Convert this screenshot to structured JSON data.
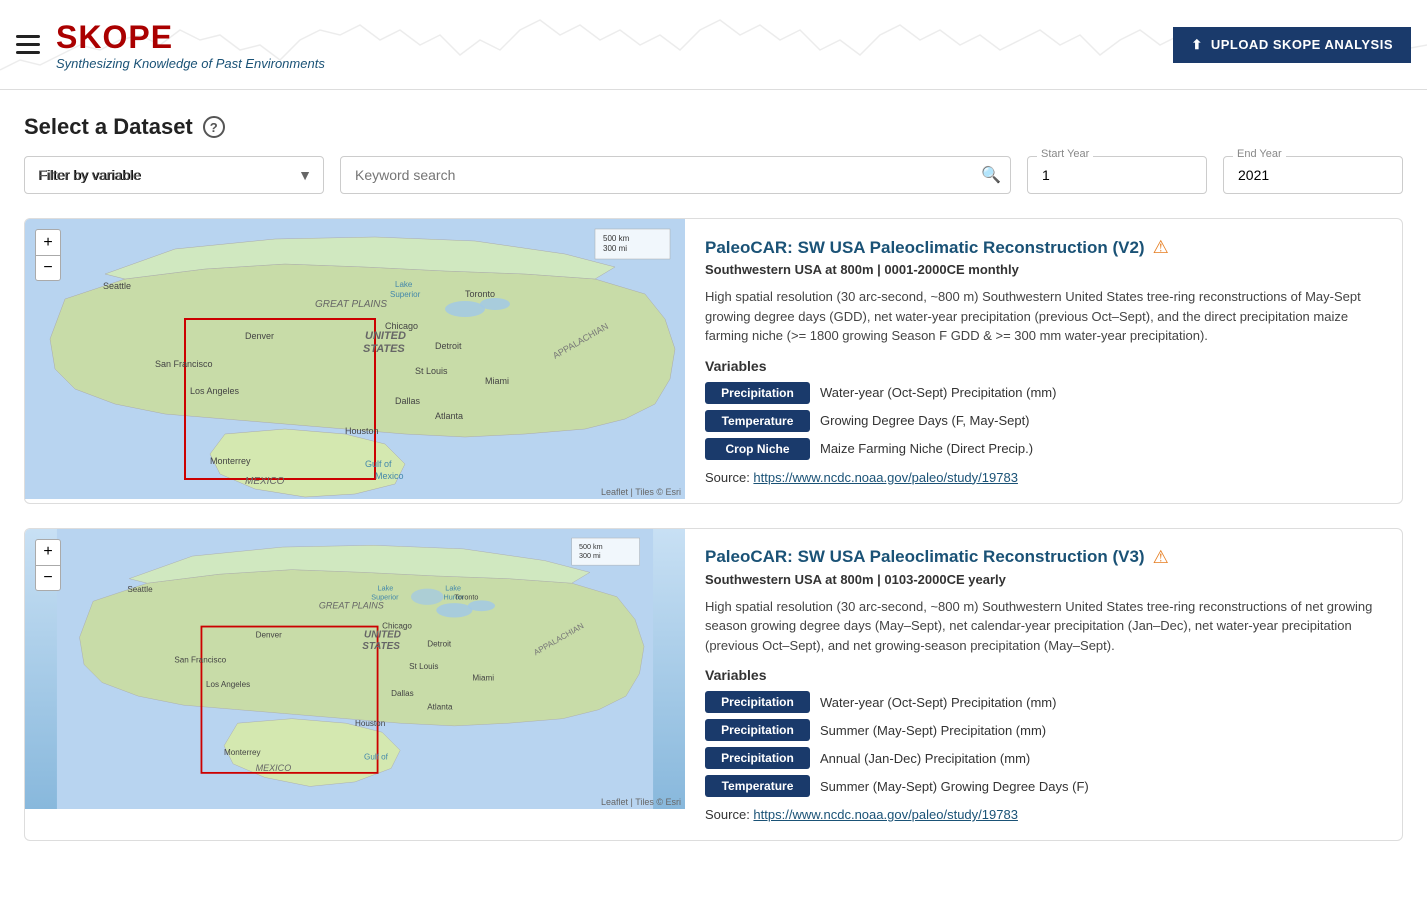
{
  "header": {
    "logo": "SKOPE",
    "subtitle": "Synthesizing Knowledge of Past Environments",
    "upload_button": "UPLOAD SKOPE ANALYSIS"
  },
  "section": {
    "title": "Select a Dataset",
    "help": "?"
  },
  "filters": {
    "variable_placeholder": "Filter by variable",
    "keyword_placeholder": "Keyword search",
    "start_year_label": "Start Year",
    "start_year_value": "1",
    "end_year_label": "End Year",
    "end_year_value": "2021"
  },
  "datasets": [
    {
      "id": "v2",
      "title": "PaleoCAR: SW USA Paleoclimatic Reconstruction (V2)",
      "subtitle": "Southwestern USA at 800m | 0001-2000CE monthly",
      "description": "High spatial resolution (30 arc-second, ~800 m) Southwestern United States tree-ring reconstructions of May-Sept growing degree days (GDD), net water-year precipitation (previous Oct–Sept), and the direct precipitation maize farming niche (>= 1800 growing Season F GDD & >= 300 mm water-year precipitation).",
      "variables_label": "Variables",
      "variables": [
        {
          "badge": "Precipitation",
          "desc": "Water-year (Oct-Sept) Precipitation (mm)"
        },
        {
          "badge": "Temperature",
          "desc": "Growing Degree Days (F, May-Sept)"
        },
        {
          "badge": "Crop Niche",
          "desc": "Maize Farming Niche (Direct Precip.)"
        }
      ],
      "source_text": "Source: ",
      "source_link": "https://www.ncdc.noaa.gov/paleo/study/19783",
      "source_link_text": "https://www.ncdc.noaa.gov/paleo/study/19783",
      "has_warning": true
    },
    {
      "id": "v3",
      "title": "PaleoCAR: SW USA Paleoclimatic Reconstruction (V3)",
      "subtitle": "Southwestern USA at 800m | 0103-2000CE yearly",
      "description": "High spatial resolution (30 arc-second, ~800 m) Southwestern United States tree-ring reconstructions of net growing season growing degree days (May–Sept), net calendar-year precipitation (Jan–Dec), net water-year precipitation (previous Oct–Sept), and net growing-season precipitation (May–Sept).",
      "variables_label": "Variables",
      "variables": [
        {
          "badge": "Precipitation",
          "desc": "Water-year (Oct-Sept) Precipitation (mm)"
        },
        {
          "badge": "Precipitation",
          "desc": "Summer (May-Sept) Precipitation (mm)"
        },
        {
          "badge": "Precipitation",
          "desc": "Annual (Jan-Dec) Precipitation (mm)"
        },
        {
          "badge": "Temperature",
          "desc": "Summer (May-Sept) Growing Degree Days (F)"
        }
      ],
      "source_text": "Source: ",
      "source_link": "https://www.ncdc.noaa.gov/paleo/study/19783",
      "source_link_text": "https://www.ncdc.noaa.gov/paleo/study/19783",
      "has_warning": true
    }
  ]
}
